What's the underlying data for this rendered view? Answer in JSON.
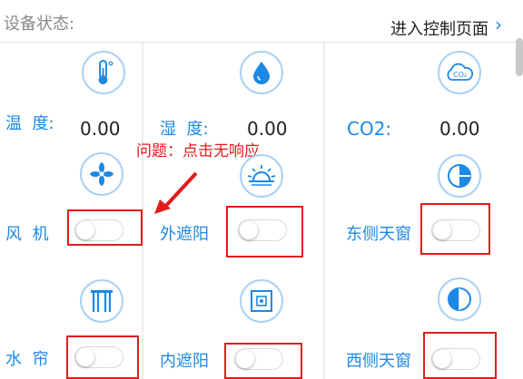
{
  "header": {
    "title": "设备状态:",
    "link_label": "进入控制页面",
    "link_arrow": "›"
  },
  "sensors": {
    "temp": {
      "label": "温  度:",
      "value": "0.00",
      "icon": "thermometer-icon"
    },
    "humidity": {
      "label": "湿  度:",
      "value": "0.00",
      "icon": "water-drop-icon"
    },
    "co2": {
      "label": "CO2:",
      "value": "0.00",
      "icon": "co2-cloud-icon"
    }
  },
  "devices": {
    "fan": {
      "label": "风  机",
      "icon": "fan-icon",
      "on": false
    },
    "outer_shade": {
      "label": "外遮阳",
      "icon": "sunrise-icon",
      "on": false
    },
    "east_window": {
      "label": "东侧天窗",
      "icon": "window-half-icon",
      "on": false
    },
    "water_curtain": {
      "label": "水  帘",
      "icon": "curtain-icon",
      "on": false
    },
    "inner_shade": {
      "label": "内遮阳",
      "icon": "inner-shade-icon",
      "on": false
    },
    "west_window": {
      "label": "西侧天窗",
      "icon": "window-side-icon",
      "on": false
    }
  },
  "annotation": {
    "text": "问题：点击无响应"
  },
  "colors": {
    "accent": "#1e88e5",
    "icon_ring": "#a9d1f5",
    "annotation": "#e31b1b"
  }
}
